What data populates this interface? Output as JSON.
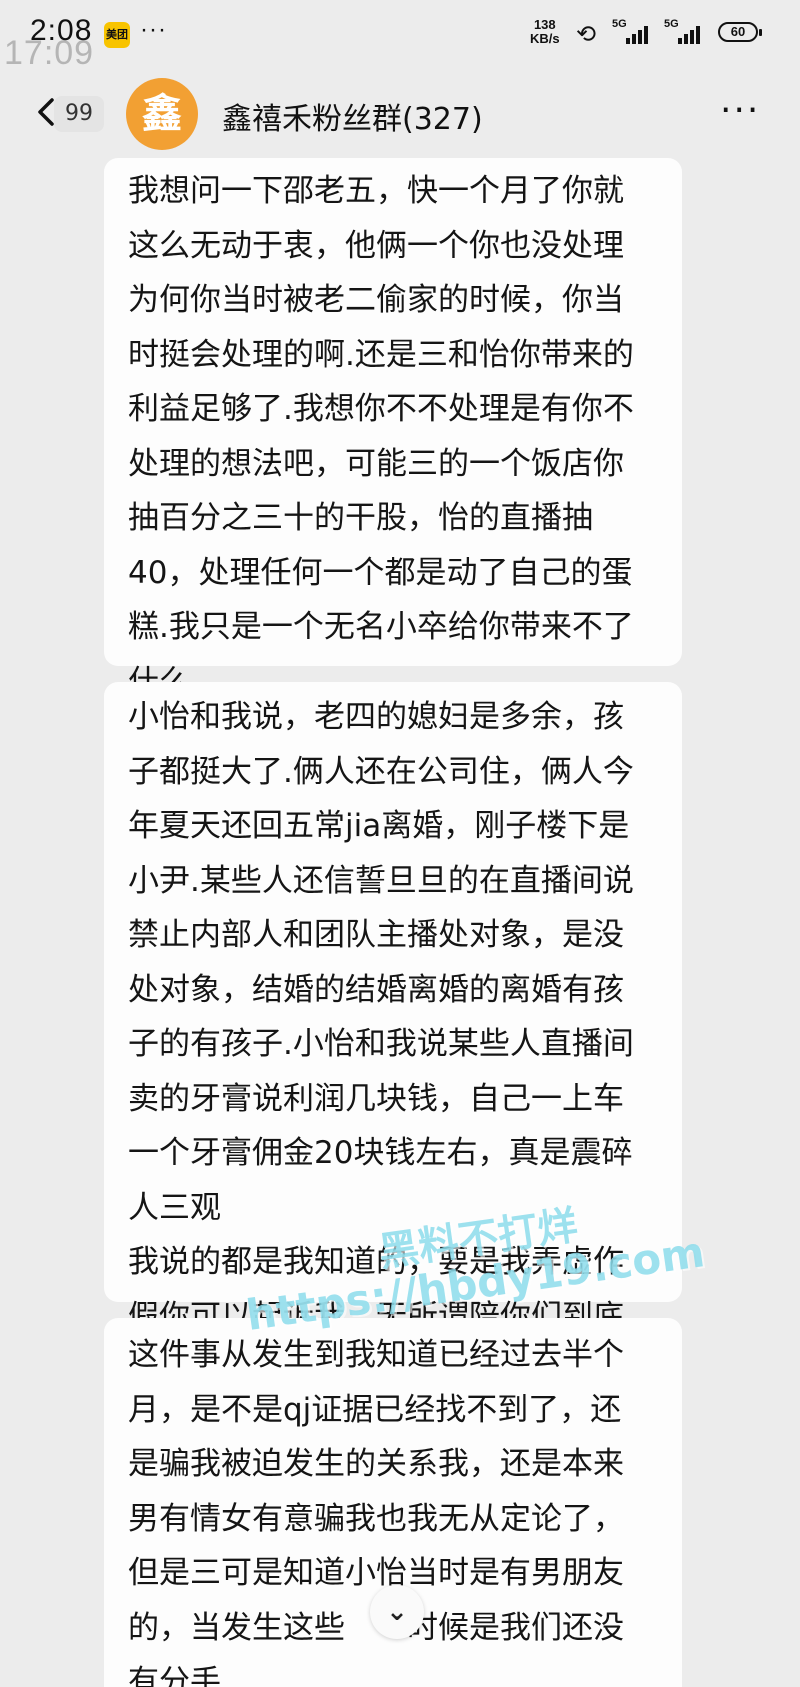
{
  "status_bar": {
    "time": "2:08",
    "overlay_time": "17:09",
    "app_badge": "美团",
    "more_dots": "···",
    "net_speed_value": "138",
    "net_speed_unit": "KB/s",
    "signal_1_label": "5G",
    "signal_2_label": "5G",
    "battery": "60"
  },
  "header": {
    "unread_count": "99",
    "avatar_char": "鑫",
    "title": "鑫禧禾粉丝群(327)",
    "more_icon": "···"
  },
  "messages": [
    {
      "lines": [
        "我想问一下邵老五，快一个月了你就",
        "这么无动于衷，他俩一个你也没处理",
        "为何你当时被老二偷家的时候，你当",
        "时挺会处理的啊.还是三和怡你带来的",
        "利益足够了.我想你不不处理是有你不",
        "处理的想法吧，可能三的一个饭店你",
        "抽百分之三十的干股，怡的直播抽",
        "40，处理任何一个都是动了自己的蛋",
        "糕.我只是一个无名小卒给你带来不了",
        "什么."
      ]
    },
    {
      "lines": [
        "小怡和我说，老四的媳妇是多余，孩",
        "子都挺大了.俩人还在公司住，俩人今",
        "年夏天还回五常jia离婚，刚子楼下是",
        "小尹.某些人还信誓旦旦的在直播间说",
        "禁止内部人和团队主播处对象，是没",
        "处对象，结婚的结婚离婚的离婚有孩",
        "子的有孩子.小怡和我说某些人直播间",
        "卖的牙膏说利润几块钱，自己一上车",
        "一个牙膏佣金20块钱左右，真是震碎",
        "人三观",
        "我说的都是我知道的，要是我弄虚作",
        "假你可以起诉我，无所谓陪你们到底."
      ]
    },
    {
      "lines": [
        "这件事从发生到我知道已经过去半个",
        "月，是不是qj证据已经找不到了，还",
        "是骗我被迫发生的关系我，还是本来",
        "男有情女有意骗我也我无从定论了，",
        "但是三可是知道小怡当时是有男朋友",
        "的，当发生这些　　时候是我们还没",
        "有分手."
      ]
    }
  ],
  "watermark": {
    "line1": "黑料不打烊",
    "line2": "https://hbdy19.com"
  },
  "scroll_button_icon": "chevron-double-down",
  "scroll_button_glyph": "⌄"
}
